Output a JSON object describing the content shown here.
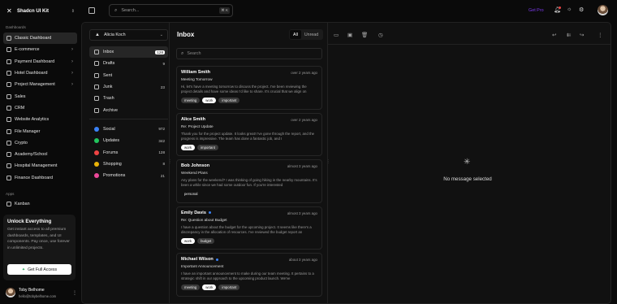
{
  "brand": {
    "name": "Shadcn UI Kit"
  },
  "sidebar": {
    "section_dashboards": "Dashboards",
    "dashboards": [
      {
        "label": "Classic Dashboard",
        "active": true,
        "has_submenu": false
      },
      {
        "label": "E-commerce",
        "active": false,
        "has_submenu": true
      },
      {
        "label": "Payment Dashboard",
        "active": false,
        "has_submenu": true
      },
      {
        "label": "Hotel Dashboard",
        "active": false,
        "has_submenu": true
      },
      {
        "label": "Project Management",
        "active": false,
        "has_submenu": true
      },
      {
        "label": "Sales",
        "active": false,
        "has_submenu": false
      },
      {
        "label": "CRM",
        "active": false,
        "has_submenu": false
      },
      {
        "label": "Website Analytics",
        "active": false,
        "has_submenu": false
      },
      {
        "label": "File Manager",
        "active": false,
        "has_submenu": false
      },
      {
        "label": "Crypto",
        "active": false,
        "has_submenu": false
      },
      {
        "label": "Academy/School",
        "active": false,
        "has_submenu": false
      },
      {
        "label": "Hospital Management",
        "active": false,
        "has_submenu": false
      },
      {
        "label": "Finance Dashboard",
        "active": false,
        "has_submenu": false
      }
    ],
    "section_apps": "Apps",
    "apps": [
      {
        "label": "Kanban"
      }
    ]
  },
  "unlock": {
    "title": "Unlock Everything",
    "text": "Get instant access to all premium dashboards, templates, and UI components. Pay once, use forever in unlimited projects.",
    "button": "Get Full Access"
  },
  "user": {
    "name": "Toby Belhome",
    "email": "hello@tobybelhome.com"
  },
  "topbar": {
    "search_placeholder": "Search...",
    "shortcut": "⌘ K",
    "get_pro": "Get Pro"
  },
  "mail": {
    "account": "Alicia Koch",
    "title": "Inbox",
    "tabs": {
      "all": "All",
      "unread": "Unread"
    },
    "search_placeholder": "Search",
    "folders": [
      {
        "label": "Inbox",
        "count": "128",
        "active": true
      },
      {
        "label": "Drafts",
        "count": "9"
      },
      {
        "label": "Sent",
        "count": ""
      },
      {
        "label": "Junk",
        "count": "23"
      },
      {
        "label": "Trash",
        "count": ""
      },
      {
        "label": "Archive",
        "count": ""
      }
    ],
    "categories": [
      {
        "label": "Social",
        "count": "972",
        "color": "#3b82f6"
      },
      {
        "label": "Updates",
        "count": "342",
        "color": "#22c55e"
      },
      {
        "label": "Forums",
        "count": "128",
        "color": "#ef4444"
      },
      {
        "label": "Shopping",
        "count": "8",
        "color": "#eab308"
      },
      {
        "label": "Promotions",
        "count": "21",
        "color": "#ec4899"
      }
    ],
    "messages": [
      {
        "from": "William Smith",
        "unread": false,
        "date": "over 2 years ago",
        "subject": "Meeting Tomorrow",
        "preview": "Hi, let's have a meeting tomorrow to discuss the project. I've been reviewing the project details and have some ideas I'd like to share. It's crucial that we align on",
        "tags": [
          "meeting",
          "work",
          "important"
        ]
      },
      {
        "from": "Alice Smith",
        "unread": false,
        "date": "over 2 years ago",
        "subject": "Re: Project Update",
        "preview": "Thank you for the project update. It looks great! I've gone through the report, and the progress is impressive. The team has done a fantastic job, and I",
        "tags": [
          "work",
          "important"
        ]
      },
      {
        "from": "Bob Johnson",
        "unread": false,
        "date": "almost 3 years ago",
        "subject": "Weekend Plans",
        "preview": "Any plans for the weekend? I was thinking of going hiking in the nearby mountains. It's been a while since we had some outdoor fun. If you're interested",
        "tags": [
          "personal"
        ]
      },
      {
        "from": "Emily Davis",
        "unread": true,
        "date": "almost 3 years ago",
        "subject": "Re: Question about Budget",
        "preview": "I have a question about the budget for the upcoming project. It seems like there's a discrepancy in the allocation of resources. I've reviewed the budget report an",
        "tags": [
          "work",
          "budget"
        ]
      },
      {
        "from": "Michael Wilson",
        "unread": true,
        "date": "about 3 years ago",
        "subject": "Important Announcement",
        "preview": "I have an important announcement to make during our team meeting. It pertains to a strategic shift in our approach to the upcoming product launch. We've",
        "tags": [
          "meeting",
          "work",
          "important"
        ]
      }
    ],
    "empty_text": "No message selected"
  }
}
